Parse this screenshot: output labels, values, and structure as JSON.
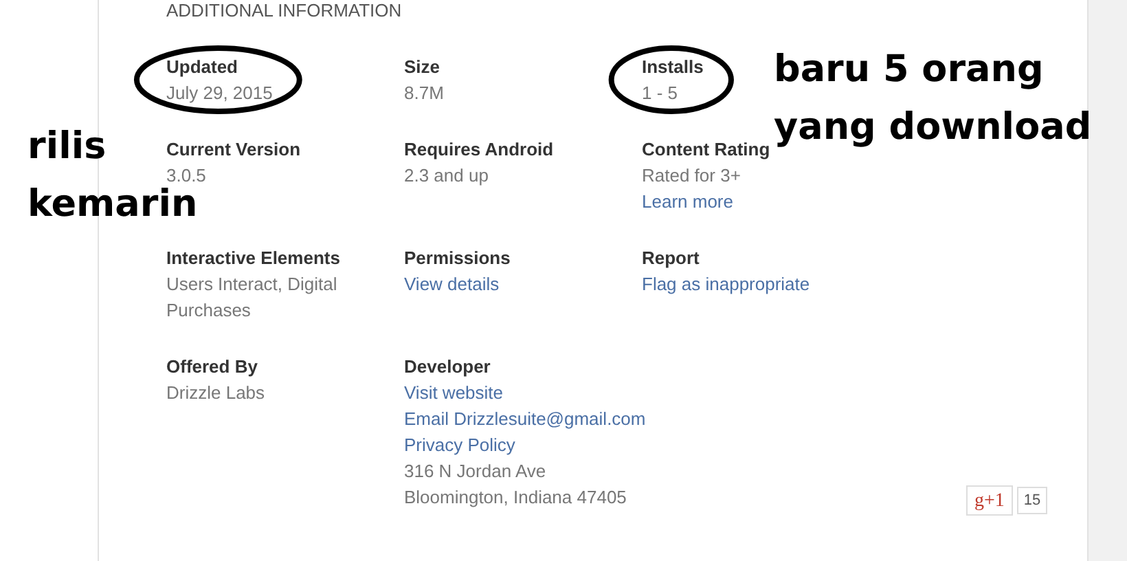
{
  "section_title": "ADDITIONAL INFORMATION",
  "fields": [
    {
      "label": "Updated",
      "circled": true,
      "lines": [
        {
          "kind": "text",
          "text": "July 29, 2015"
        }
      ]
    },
    {
      "label": "Size",
      "circled": false,
      "lines": [
        {
          "kind": "text",
          "text": "8.7M"
        }
      ]
    },
    {
      "label": "Installs",
      "circled": true,
      "lines": [
        {
          "kind": "text",
          "text": "1 - 5"
        }
      ]
    },
    {
      "label": "Current Version",
      "circled": false,
      "lines": [
        {
          "kind": "text",
          "text": "3.0.5"
        }
      ]
    },
    {
      "label": "Requires Android",
      "circled": false,
      "lines": [
        {
          "kind": "text",
          "text": "2.3 and up"
        }
      ]
    },
    {
      "label": "Content Rating",
      "circled": false,
      "lines": [
        {
          "kind": "text",
          "text": "Rated for 3+"
        },
        {
          "kind": "link",
          "text": "Learn more"
        }
      ]
    },
    {
      "label": "Interactive Elements",
      "circled": false,
      "lines": [
        {
          "kind": "text",
          "text": "Users Interact, Digital Purchases"
        }
      ]
    },
    {
      "label": "Permissions",
      "circled": false,
      "lines": [
        {
          "kind": "link",
          "text": "View details"
        }
      ]
    },
    {
      "label": "Report",
      "circled": false,
      "lines": [
        {
          "kind": "link",
          "text": "Flag as inappropriate"
        }
      ]
    },
    {
      "label": "Offered By",
      "circled": false,
      "lines": [
        {
          "kind": "text",
          "text": "Drizzle Labs"
        }
      ]
    },
    {
      "label": "Developer",
      "circled": false,
      "lines": [
        {
          "kind": "link",
          "text": "Visit website"
        },
        {
          "kind": "link",
          "text": "Email Drizzlesuite@gmail.com"
        },
        {
          "kind": "link",
          "text": "Privacy Policy"
        },
        {
          "kind": "text",
          "text": "316 N Jordan Ave"
        },
        {
          "kind": "text",
          "text": "Bloomington, Indiana 47405"
        }
      ]
    }
  ],
  "plus_button": {
    "label": "g+1",
    "count": "15"
  },
  "annotations": [
    {
      "lines": [
        "rilis",
        "kemarin"
      ]
    },
    {
      "lines": [
        "baru 5 orang",
        "yang download"
      ]
    }
  ]
}
